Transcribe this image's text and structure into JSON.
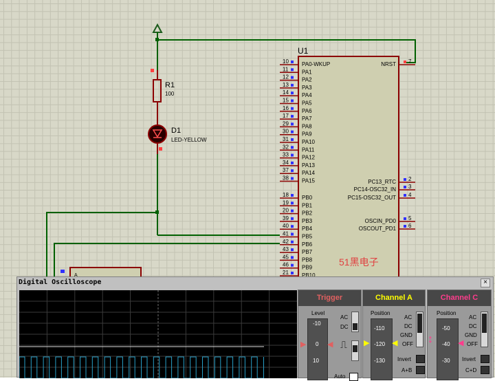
{
  "schematic": {
    "r1": {
      "ref": "R1",
      "value": "100"
    },
    "d1": {
      "ref": "D1",
      "value": "LED-YELLOW"
    },
    "u1": {
      "ref": "U1",
      "left_pins": [
        {
          "num": "10",
          "name": "PA0-WKUP"
        },
        {
          "num": "11",
          "name": "PA1"
        },
        {
          "num": "12",
          "name": "PA2"
        },
        {
          "num": "13",
          "name": "PA3"
        },
        {
          "num": "14",
          "name": "PA4"
        },
        {
          "num": "15",
          "name": "PA5"
        },
        {
          "num": "16",
          "name": "PA6"
        },
        {
          "num": "17",
          "name": "PA7"
        },
        {
          "num": "29",
          "name": "PA8"
        },
        {
          "num": "30",
          "name": "PA9"
        },
        {
          "num": "31",
          "name": "PA10"
        },
        {
          "num": "32",
          "name": "PA11"
        },
        {
          "num": "33",
          "name": "PA12"
        },
        {
          "num": "34",
          "name": "PA13"
        },
        {
          "num": "37",
          "name": "PA14"
        },
        {
          "num": "38",
          "name": "PA15"
        },
        {
          "num": "18",
          "name": "PB0"
        },
        {
          "num": "19",
          "name": "PB1"
        },
        {
          "num": "20",
          "name": "PB2"
        },
        {
          "num": "39",
          "name": "PB3"
        },
        {
          "num": "40",
          "name": "PB4"
        },
        {
          "num": "41",
          "name": "PB5"
        },
        {
          "num": "42",
          "name": "PB6"
        },
        {
          "num": "43",
          "name": "PB7"
        },
        {
          "num": "45",
          "name": "PB8"
        },
        {
          "num": "46",
          "name": "PB9"
        },
        {
          "num": "21",
          "name": "PB10"
        }
      ],
      "right_pins": [
        {
          "num": "7",
          "name": "NRST"
        },
        {
          "num": "2",
          "name": "PC13_RTC"
        },
        {
          "num": "3",
          "name": "PC14-OSC32_IN"
        },
        {
          "num": "4",
          "name": "PC15-OSC32_OUT"
        },
        {
          "num": "5",
          "name": "OSCIN_PD0"
        },
        {
          "num": "6",
          "name": "OSCOUT_PD1"
        }
      ],
      "watermark": "51黑电子"
    },
    "small_part_label": "A"
  },
  "oscilloscope": {
    "title": "Digital Oscilloscope",
    "close_glyph": "×",
    "trigger": {
      "title": "Trigger",
      "level_label": "Level",
      "scale": [
        "-10",
        "0",
        "10"
      ],
      "ac": "AC",
      "dc": "DC",
      "auto": "Auto"
    },
    "channel_a": {
      "title": "Channel A",
      "position_label": "Position",
      "scale": [
        "-110",
        "-120",
        "-130"
      ],
      "coupling": [
        "AC",
        "DC",
        "GND",
        "OFF"
      ],
      "invert": "Invert",
      "sum": "A+B",
      "color": "#ffff00"
    },
    "channel_c": {
      "title": "Channel C",
      "position_label": "Position",
      "scale": [
        "-50",
        "-40",
        "-30"
      ],
      "coupling": [
        "AC",
        "DC",
        "GND",
        "OFF"
      ],
      "invert": "Invert",
      "sum": "C+D",
      "color": "#ff3c8c"
    },
    "trigger_color": "#e06060",
    "trace_color": "#28a0c8",
    "pulse_count": 20
  }
}
